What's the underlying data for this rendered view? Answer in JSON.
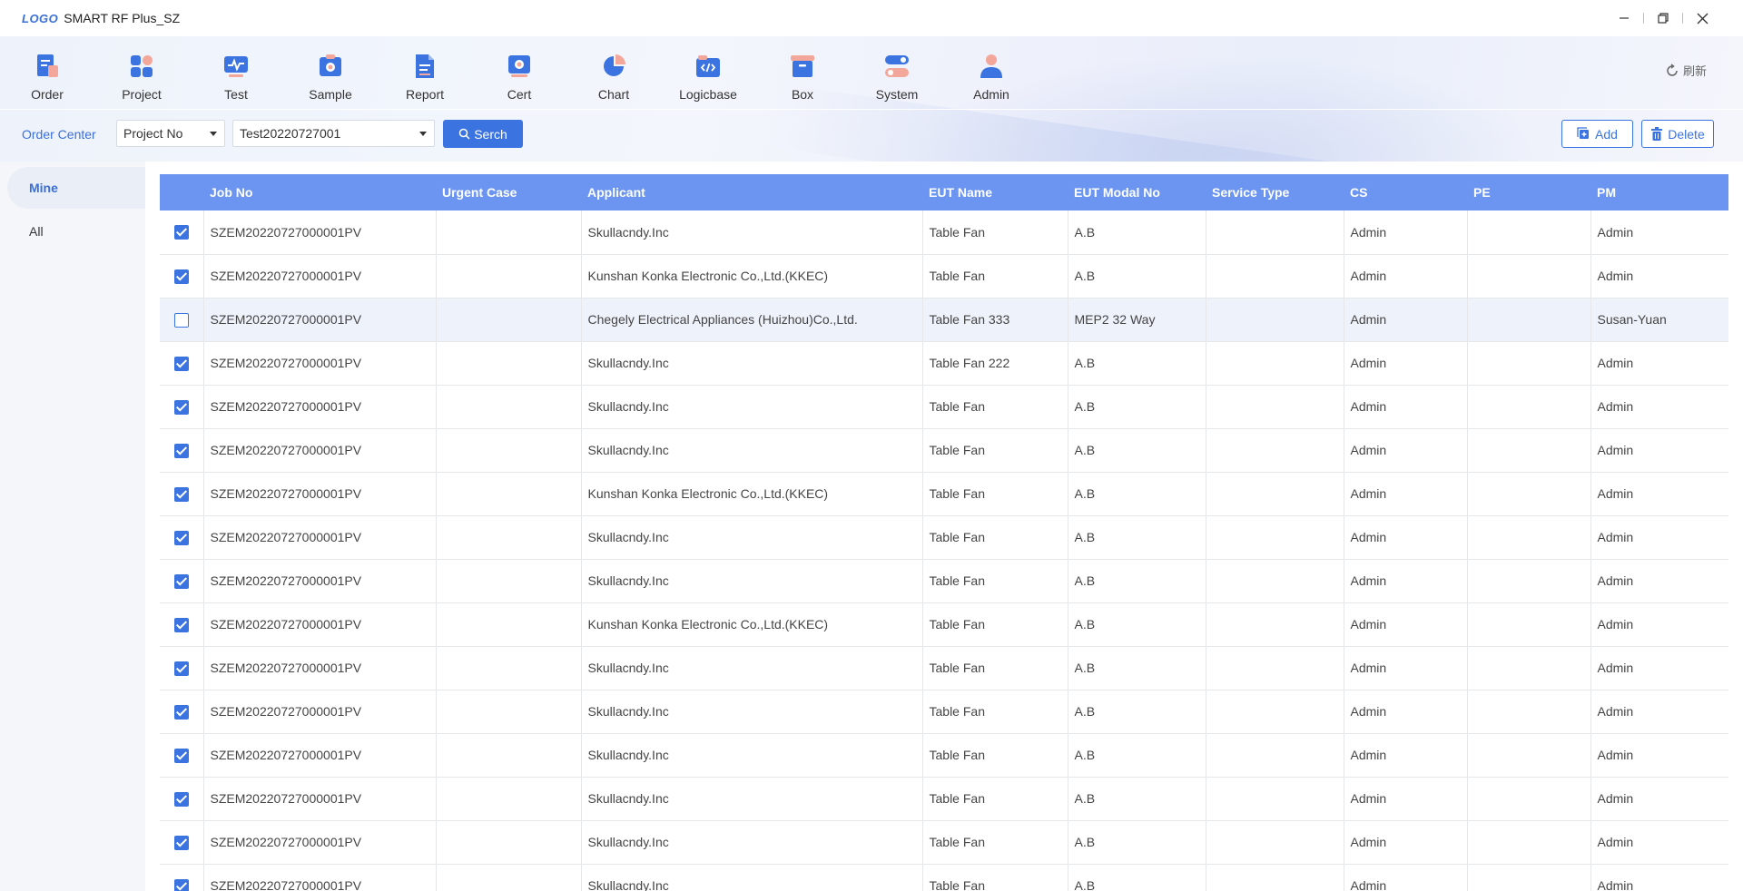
{
  "window": {
    "logo": "LOGO",
    "title": "SMART RF Plus_SZ"
  },
  "nav": [
    {
      "label": "Order",
      "icon": "order-icon"
    },
    {
      "label": "Project",
      "icon": "project-icon"
    },
    {
      "label": "Test",
      "icon": "test-icon"
    },
    {
      "label": "Sample",
      "icon": "sample-icon"
    },
    {
      "label": "Report",
      "icon": "report-icon"
    },
    {
      "label": "Cert",
      "icon": "cert-icon"
    },
    {
      "label": "Chart",
      "icon": "chart-icon"
    },
    {
      "label": "Logicbase",
      "icon": "logicbase-icon"
    },
    {
      "label": "Box",
      "icon": "box-icon"
    },
    {
      "label": "System",
      "icon": "system-icon"
    },
    {
      "label": "Admin",
      "icon": "admin-icon"
    }
  ],
  "refresh_label": "刷新",
  "filter": {
    "section_label": "Order Center",
    "field_select": "Project No",
    "value_select": "Test20220727001",
    "search_label": "Serch",
    "add_label": "Add",
    "delete_label": "Delete"
  },
  "sidebar": {
    "items": [
      {
        "label": "Mine",
        "active": true
      },
      {
        "label": "All",
        "active": false
      }
    ]
  },
  "table": {
    "columns": [
      "",
      "Job No",
      "Urgent Case",
      "Applicant",
      "EUT Name",
      "EUT Modal No",
      "Service Type",
      "CS",
      "PE",
      "PM"
    ],
    "rows": [
      {
        "checked": true,
        "job_no": "SZEM20220727000001PV",
        "urgent": "",
        "applicant": "Skullacndy.Inc",
        "eut_name": "Table Fan",
        "eut_modal": "A.B",
        "service": "",
        "cs": "Admin",
        "pe": "",
        "pm": "Admin"
      },
      {
        "checked": true,
        "job_no": "SZEM20220727000001PV",
        "urgent": "",
        "applicant": "Kunshan Konka Electronic Co.,Ltd.(KKEC)",
        "eut_name": "Table Fan",
        "eut_modal": "A.B",
        "service": "",
        "cs": "Admin",
        "pe": "",
        "pm": "Admin"
      },
      {
        "checked": false,
        "job_no": "SZEM20220727000001PV",
        "urgent": "",
        "applicant": "Chegely Electrical Appliances (Huizhou)Co.,Ltd.",
        "eut_name": "Table Fan 333",
        "eut_modal": "MEP2 32 Way",
        "service": "",
        "cs": "Admin",
        "pe": "",
        "pm": "Susan-Yuan"
      },
      {
        "checked": true,
        "job_no": "SZEM20220727000001PV",
        "urgent": "",
        "applicant": "Skullacndy.Inc",
        "eut_name": "Table Fan 222",
        "eut_modal": "A.B",
        "service": "",
        "cs": "Admin",
        "pe": "",
        "pm": "Admin"
      },
      {
        "checked": true,
        "job_no": "SZEM20220727000001PV",
        "urgent": "",
        "applicant": "Skullacndy.Inc",
        "eut_name": "Table Fan",
        "eut_modal": "A.B",
        "service": "",
        "cs": "Admin",
        "pe": "",
        "pm": "Admin"
      },
      {
        "checked": true,
        "job_no": "SZEM20220727000001PV",
        "urgent": "",
        "applicant": "Skullacndy.Inc",
        "eut_name": "Table Fan",
        "eut_modal": "A.B",
        "service": "",
        "cs": "Admin",
        "pe": "",
        "pm": "Admin"
      },
      {
        "checked": true,
        "job_no": "SZEM20220727000001PV",
        "urgent": "",
        "applicant": "Kunshan Konka Electronic Co.,Ltd.(KKEC)",
        "eut_name": "Table Fan",
        "eut_modal": "A.B",
        "service": "",
        "cs": "Admin",
        "pe": "",
        "pm": "Admin"
      },
      {
        "checked": true,
        "job_no": "SZEM20220727000001PV",
        "urgent": "",
        "applicant": "Skullacndy.Inc",
        "eut_name": "Table Fan",
        "eut_modal": "A.B",
        "service": "",
        "cs": "Admin",
        "pe": "",
        "pm": "Admin"
      },
      {
        "checked": true,
        "job_no": "SZEM20220727000001PV",
        "urgent": "",
        "applicant": "Skullacndy.Inc",
        "eut_name": "Table Fan",
        "eut_modal": "A.B",
        "service": "",
        "cs": "Admin",
        "pe": "",
        "pm": "Admin"
      },
      {
        "checked": true,
        "job_no": "SZEM20220727000001PV",
        "urgent": "",
        "applicant": "Kunshan Konka Electronic Co.,Ltd.(KKEC)",
        "eut_name": "Table Fan",
        "eut_modal": "A.B",
        "service": "",
        "cs": "Admin",
        "pe": "",
        "pm": "Admin"
      },
      {
        "checked": true,
        "job_no": "SZEM20220727000001PV",
        "urgent": "",
        "applicant": "Skullacndy.Inc",
        "eut_name": "Table Fan",
        "eut_modal": "A.B",
        "service": "",
        "cs": "Admin",
        "pe": "",
        "pm": "Admin"
      },
      {
        "checked": true,
        "job_no": "SZEM20220727000001PV",
        "urgent": "",
        "applicant": "Skullacndy.Inc",
        "eut_name": "Table Fan",
        "eut_modal": "A.B",
        "service": "",
        "cs": "Admin",
        "pe": "",
        "pm": "Admin"
      },
      {
        "checked": true,
        "job_no": "SZEM20220727000001PV",
        "urgent": "",
        "applicant": "Skullacndy.Inc",
        "eut_name": "Table Fan",
        "eut_modal": "A.B",
        "service": "",
        "cs": "Admin",
        "pe": "",
        "pm": "Admin"
      },
      {
        "checked": true,
        "job_no": "SZEM20220727000001PV",
        "urgent": "",
        "applicant": "Skullacndy.Inc",
        "eut_name": "Table Fan",
        "eut_modal": "A.B",
        "service": "",
        "cs": "Admin",
        "pe": "",
        "pm": "Admin"
      },
      {
        "checked": true,
        "job_no": "SZEM20220727000001PV",
        "urgent": "",
        "applicant": "Skullacndy.Inc",
        "eut_name": "Table Fan",
        "eut_modal": "A.B",
        "service": "",
        "cs": "Admin",
        "pe": "",
        "pm": "Admin"
      },
      {
        "checked": true,
        "job_no": "SZEM20220727000001PV",
        "urgent": "",
        "applicant": "Skullacndy.Inc",
        "eut_name": "Table Fan",
        "eut_modal": "A.B",
        "service": "",
        "cs": "Admin",
        "pe": "",
        "pm": "Admin"
      }
    ],
    "highlight_row": 2
  },
  "colors": {
    "accent": "#3b74e0",
    "header_bg": "#6c95f1",
    "link": "#3a6fd8"
  }
}
